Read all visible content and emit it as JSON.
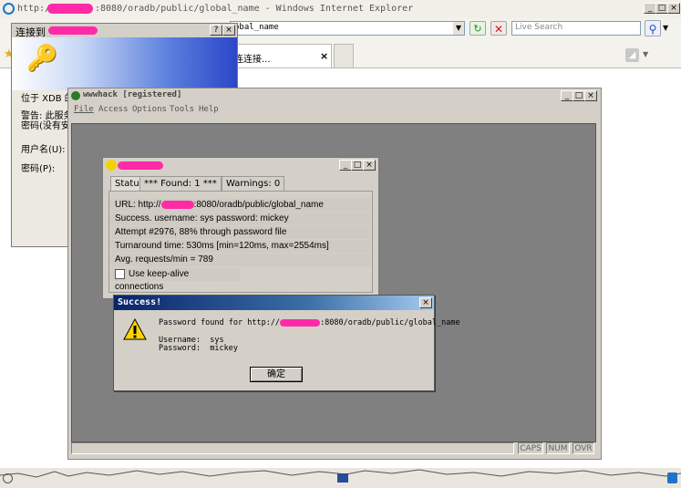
{
  "ie": {
    "title_prefix": "http://",
    "title_suffix": ":8080/oradb/public/global_name - Windows Internet Explorer",
    "address_fragment": "obal_name",
    "search_placeholder": "Live Search",
    "tab_label": "连连接...",
    "buttons": {
      "minimize": "_",
      "maximize": "□",
      "close": "×"
    }
  },
  "login": {
    "title": "连接到",
    "line1": "位于 XDB 的",
    "line2": "警告: 此服务",
    "line3": "密码(没有安",
    "username_label": "用户名(U):",
    "password_label": "密码(P):"
  },
  "wwwhack": {
    "title": "wwwhack [registered]",
    "menu": [
      "File",
      "Access",
      "Options",
      "Tools",
      "Help"
    ],
    "status_cells": [
      "CAPS",
      "NUM",
      "OVR"
    ]
  },
  "status_window": {
    "tabs": [
      "Status",
      "*** Found: 1 ***",
      "Warnings: 0"
    ],
    "url_prefix": "URL: http://",
    "url_suffix": ":8080/oradb/public/global_name",
    "rows": [
      "Success.  username: sys  password: mickey",
      "Attempt #2976, 88% through password file",
      "Turnaround time: 530ms [min=120ms, max=2554ms]",
      "Avg. requests/min = 789"
    ],
    "keepalive_label": "Use keep-alive connections",
    "keepalive_checked": false
  },
  "success_dialog": {
    "title": "Success!",
    "message_prefix": "Password found for http://",
    "message_suffix": ":8080/oradb/public/global_name",
    "username_line": "Username:  sys",
    "password_line": "Password:  mickey",
    "ok_label": "确定",
    "icon": "warning-icon"
  },
  "colors": {
    "redaction": "#ff2aa8",
    "dialog_title": "#0a246a",
    "mdi_background": "#808080"
  }
}
